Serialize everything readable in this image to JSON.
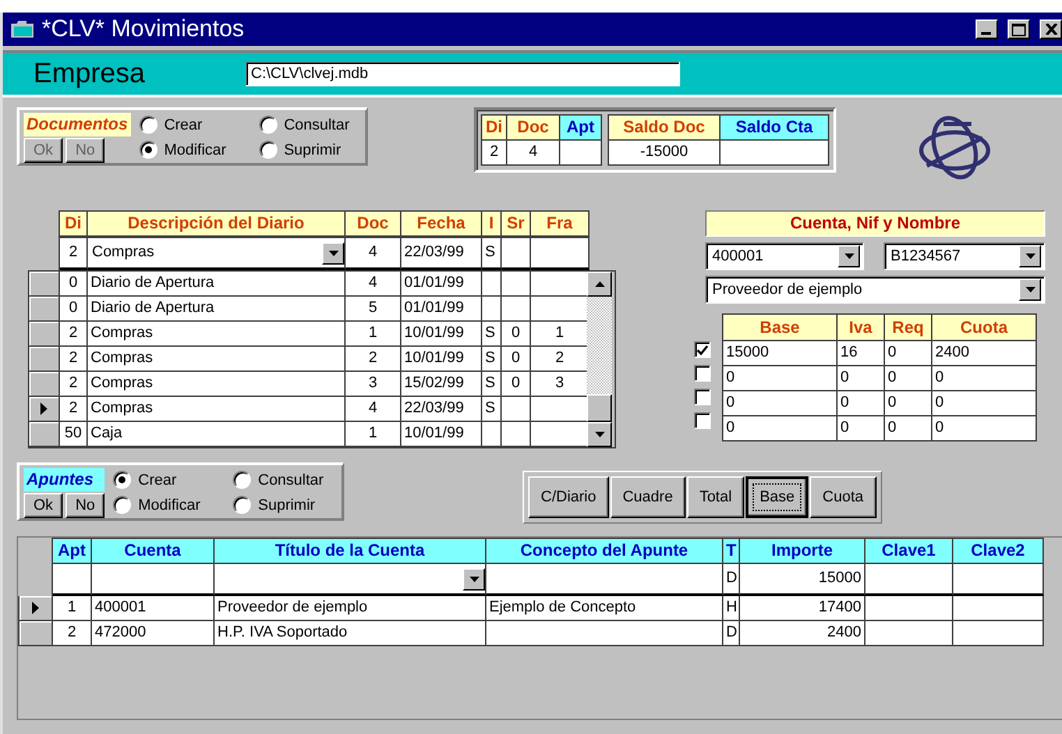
{
  "window": {
    "title": "*CLV* Movimientos"
  },
  "empresa": {
    "label": "Empresa",
    "value": "C:\\CLV\\clvej.mdb"
  },
  "documentos": {
    "title": "Documentos",
    "buttons": [
      {
        "label": "Ok",
        "disabled": true
      },
      {
        "label": "No",
        "disabled": true
      }
    ],
    "options": [
      {
        "label": "Crear",
        "selected": false
      },
      {
        "label": "Consultar",
        "selected": false
      },
      {
        "label": "Modificar",
        "selected": true
      },
      {
        "label": "Suprimir",
        "selected": false
      }
    ]
  },
  "summary": {
    "document": [
      {
        "label": "Di",
        "kind": "doc",
        "value": "2"
      },
      {
        "label": "Doc",
        "kind": "doc",
        "value": "4"
      },
      {
        "label": "Apt",
        "kind": "apt"
      }
    ],
    "saldos": [
      {
        "label": "Saldo Doc",
        "kind": "doc",
        "value": "-15000"
      },
      {
        "label": "Saldo Cta",
        "kind": "apt"
      }
    ]
  },
  "diario": {
    "columns": [
      {
        "label": "Di",
        "kind": "doc"
      },
      {
        "label": "Descripción del Diario",
        "kind": "doc"
      },
      {
        "label": "Doc",
        "kind": "doc"
      },
      {
        "label": "Fecha",
        "kind": "doc"
      },
      {
        "label": "I",
        "kind": "doc"
      },
      {
        "label": "Sr",
        "kind": "doc"
      },
      {
        "label": "Fra",
        "kind": "doc"
      }
    ],
    "edit_row": {
      "di": "2",
      "descripcion": "Compras",
      "doc": "4",
      "fecha": "22/03/99",
      "i": "S"
    },
    "rows": [
      {
        "selected": false,
        "di": "0",
        "descripcion": "Diario de Apertura",
        "doc": "4",
        "fecha": "01/01/99"
      },
      {
        "selected": false,
        "di": "0",
        "descripcion": "Diario de Apertura",
        "doc": "5",
        "fecha": "01/01/99"
      },
      {
        "selected": false,
        "di": "2",
        "descripcion": "Compras",
        "doc": "1",
        "fecha": "10/01/99",
        "i": "S",
        "sr": "0",
        "fra": "1"
      },
      {
        "selected": false,
        "di": "2",
        "descripcion": "Compras",
        "doc": "2",
        "fecha": "10/01/99",
        "i": "S",
        "sr": "0",
        "fra": "2"
      },
      {
        "selected": false,
        "di": "2",
        "descripcion": "Compras",
        "doc": "3",
        "fecha": "15/02/99",
        "i": "S",
        "sr": "0",
        "fra": "3"
      },
      {
        "selected": true,
        "di": "2",
        "descripcion": "Compras",
        "doc": "4",
        "fecha": "22/03/99",
        "i": "S"
      },
      {
        "selected": false,
        "di": "50",
        "descripcion": "Caja",
        "doc": "1",
        "fecha": "10/01/99"
      }
    ]
  },
  "cuenta": {
    "title": "Cuenta, Nif y Nombre",
    "cuenta": "400001",
    "nif": "B1234567",
    "nombre": "Proveedor de ejemplo",
    "iva_columns": [
      {
        "label": "Base",
        "kind": "doc"
      },
      {
        "label": "Iva",
        "kind": "doc"
      },
      {
        "label": "Req",
        "kind": "doc"
      },
      {
        "label": "Cuota",
        "kind": "doc"
      }
    ],
    "iva_rows": [
      {
        "checked": true,
        "cells": [
          "15000",
          "16",
          "0",
          "2400"
        ]
      },
      {
        "checked": false,
        "cells": [
          "0",
          "0",
          "0",
          "0"
        ]
      },
      {
        "checked": false,
        "cells": [
          "0",
          "0",
          "0",
          "0"
        ]
      },
      {
        "checked": false,
        "cells": [
          "0",
          "0",
          "0",
          "0"
        ]
      }
    ]
  },
  "apuntes": {
    "title": "Apuntes",
    "buttons": [
      {
        "label": "Ok",
        "disabled": false
      },
      {
        "label": "No",
        "disabled": false
      }
    ],
    "options": [
      {
        "label": "Crear",
        "selected": true
      },
      {
        "label": "Consultar",
        "selected": false
      },
      {
        "label": "Modificar",
        "selected": false
      },
      {
        "label": "Suprimir",
        "selected": false
      }
    ]
  },
  "toolbar": [
    {
      "label": "C/Diario",
      "selected": false
    },
    {
      "label": "Cuadre",
      "selected": false
    },
    {
      "label": "Total",
      "selected": false
    },
    {
      "label": "Base",
      "selected": true
    },
    {
      "label": "Cuota",
      "selected": false
    }
  ],
  "asientos": {
    "columns": [
      {
        "label": "Apt",
        "kind": "apt"
      },
      {
        "label": "Cuenta",
        "kind": "apt"
      },
      {
        "label": "Título de la Cuenta",
        "kind": "apt"
      },
      {
        "label": "Concepto del Apunte",
        "kind": "apt"
      },
      {
        "label": "T",
        "kind": "apt"
      },
      {
        "label": "Importe",
        "kind": "apt"
      },
      {
        "label": "Clave1",
        "kind": "apt"
      },
      {
        "label": "Clave2",
        "kind": "apt"
      }
    ],
    "edit_row": {
      "t": "D",
      "importe": "15000"
    },
    "rows": [
      {
        "selected": true,
        "apt": "1",
        "cuenta": "400001",
        "titulo": "Proveedor de ejemplo",
        "concepto": "Ejemplo de Concepto",
        "t": "H",
        "importe": "17400"
      },
      {
        "selected": false,
        "apt": "2",
        "cuenta": "472000",
        "titulo": "H.P. IVA Soportado",
        "t": "D",
        "importe": "2400"
      }
    ]
  }
}
